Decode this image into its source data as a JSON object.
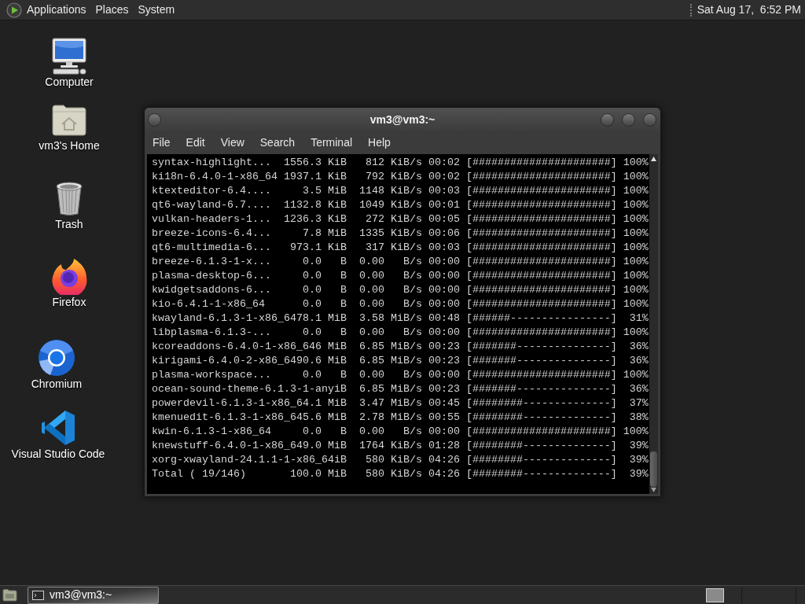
{
  "top_panel": {
    "menus": [
      "Applications",
      "Places",
      "System"
    ],
    "clock": "Sat Aug 17,  6:52 PM"
  },
  "desktop_icons": [
    {
      "label": "Computer",
      "kind": "computer"
    },
    {
      "label": "vm3's Home",
      "kind": "home"
    },
    {
      "label": "Trash",
      "kind": "trash"
    },
    {
      "label": "Firefox",
      "kind": "firefox"
    },
    {
      "label": "Chromium",
      "kind": "chromium"
    },
    {
      "label": "Visual Studio Code",
      "kind": "vscode"
    }
  ],
  "terminal_window": {
    "title": "vm3@vm3:~",
    "menu": [
      "File",
      "Edit",
      "View",
      "Search",
      "Terminal",
      "Help"
    ],
    "lines": [
      "syntax-highlight...  1556.3 KiB   812 KiB/s 00:02 [######################] 100%",
      "ki18n-6.4.0-1-x86_64 1937.1 KiB   792 KiB/s 00:02 [######################] 100%",
      "ktexteditor-6.4....     3.5 MiB  1148 KiB/s 00:03 [######################] 100%",
      "qt6-wayland-6.7....  1132.8 KiB  1049 KiB/s 00:01 [######################] 100%",
      "vulkan-headers-1...  1236.3 KiB   272 KiB/s 00:05 [######################] 100%",
      "breeze-icons-6.4...     7.8 MiB  1335 KiB/s 00:06 [######################] 100%",
      "qt6-multimedia-6...   973.1 KiB   317 KiB/s 00:03 [######################] 100%",
      "breeze-6.1.3-1-x...     0.0   B  0.00   B/s 00:00 [######################] 100%",
      "plasma-desktop-6...     0.0   B  0.00   B/s 00:00 [######################] 100%",
      "kwidgetsaddons-6...     0.0   B  0.00   B/s 00:00 [######################] 100%",
      "kio-6.4.1-1-x86_64      0.0   B  0.00   B/s 00:00 [######################] 100%",
      "kwayland-6.1.3-1-x86_6478.1 MiB  3.58 MiB/s 00:48 [######----------------]  31%",
      "libplasma-6.1.3-...     0.0   B  0.00   B/s 00:00 [######################] 100%",
      "kcoreaddons-6.4.0-1-x86_646 MiB  6.85 MiB/s 00:23 [#######---------------]  36%",
      "kirigami-6.4.0-2-x86_6490.6 MiB  6.85 MiB/s 00:23 [#######---------------]  36%",
      "plasma-workspace...     0.0   B  0.00   B/s 00:00 [######################] 100%",
      "ocean-sound-theme-6.1.3-1-anyiB  6.85 MiB/s 00:23 [#######---------------]  36%",
      "powerdevil-6.1.3-1-x86_64.1 MiB  3.47 MiB/s 00:45 [########--------------]  37%",
      "kmenuedit-6.1.3-1-x86_645.6 MiB  2.78 MiB/s 00:55 [########--------------]  38%",
      "kwin-6.1.3-1-x86_64     0.0   B  0.00   B/s 00:00 [######################] 100%",
      "knewstuff-6.4.0-1-x86_649.0 MiB  1764 KiB/s 01:28 [########--------------]  39%",
      "xorg-xwayland-24.1.1-1-x86_64iB   580 KiB/s 04:26 [########--------------]  39%",
      "Total ( 19/146)       100.0 MiB   580 KiB/s 04:26 [########--------------]  39%"
    ]
  },
  "bottom_panel": {
    "tasks": [
      {
        "label": "vm3@vm3:~",
        "selected": true
      }
    ]
  }
}
